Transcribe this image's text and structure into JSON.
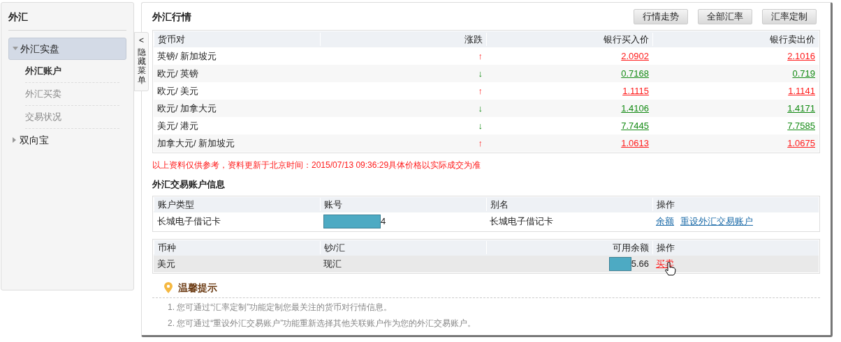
{
  "sidebar": {
    "title": "外汇",
    "items": [
      {
        "label": "外汇实盘",
        "expanded": true,
        "selected": true,
        "children": [
          {
            "label": "外汇账户",
            "selected": true
          },
          {
            "label": "外汇买卖",
            "selected": false
          },
          {
            "label": "交易状况",
            "selected": false
          }
        ]
      },
      {
        "label": "双向宝",
        "expanded": false,
        "selected": false
      }
    ],
    "hide_tab": {
      "arrow": "<",
      "label": "隐藏菜单"
    }
  },
  "market": {
    "title": "外汇行情",
    "buttons": [
      "行情走势",
      "全部汇率",
      "汇率定制"
    ],
    "columns": [
      "货币对",
      "涨跌",
      "银行买入价",
      "银行卖出价"
    ],
    "rows": [
      {
        "pair": "英镑/ 新加坡元",
        "kind": "up",
        "arrow": "↑",
        "buy": "2.0902",
        "sell": "2.1016"
      },
      {
        "pair": "欧元/ 英镑",
        "kind": "down",
        "arrow": "↓",
        "buy": "0.7168",
        "sell": "0.719"
      },
      {
        "pair": "欧元/ 美元",
        "kind": "up",
        "arrow": "↑",
        "buy": "1.1115",
        "sell": "1.1141"
      },
      {
        "pair": "欧元/ 加拿大元",
        "kind": "down",
        "arrow": "↓",
        "buy": "1.4106",
        "sell": "1.4171"
      },
      {
        "pair": "美元/ 港元",
        "kind": "down",
        "arrow": "↓",
        "buy": "7.7445",
        "sell": "7.7585"
      },
      {
        "pair": "加拿大元/ 新加坡元",
        "kind": "up",
        "arrow": "↑",
        "buy": "1.0613",
        "sell": "1.0675"
      }
    ],
    "note": "以上资料仅供参考，资料更新于北京时间：2015/07/13 09:36:29具体价格以实际成交为准"
  },
  "account": {
    "title": "外汇交易账户信息",
    "columns": [
      "账户类型",
      "账号",
      "别名",
      "操作"
    ],
    "row": {
      "type": "长城电子借记卡",
      "number": "4",
      "alias": "长城电子借记卡",
      "actions": [
        "余额",
        "重设外汇交易账户"
      ]
    },
    "balance_columns": [
      "币种",
      "钞/汇",
      "可用余额",
      "操作"
    ],
    "balance_row": {
      "currency": "美元",
      "cash_or_remit": "现汇",
      "available": "5.66",
      "action": "买卖"
    }
  },
  "tips": {
    "title": "温馨提示",
    "items": [
      "1. 您可通过“汇率定制”功能定制您最关注的货币对行情信息。",
      "2. 您可通过“重设外汇交易账户”功能重新选择其他关联账户作为您的外汇交易账户。"
    ]
  }
}
